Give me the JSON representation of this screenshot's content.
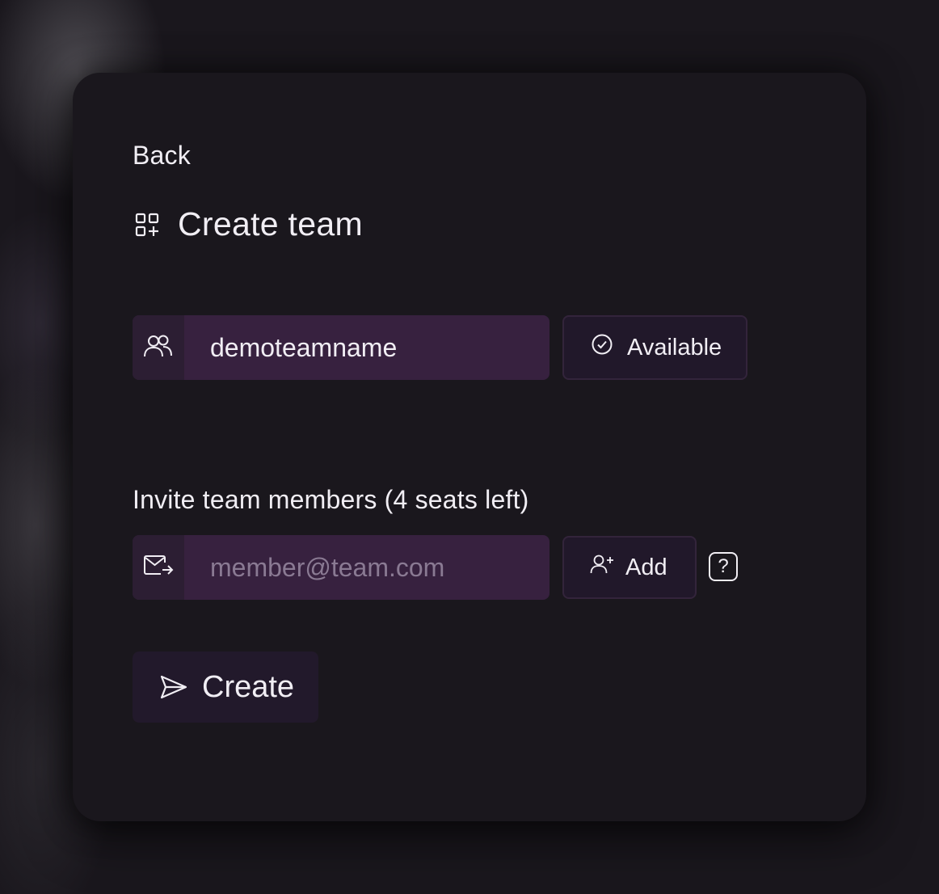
{
  "nav": {
    "back_label": "Back"
  },
  "header": {
    "title": "Create team",
    "icon": "grid-plus-icon"
  },
  "team_name": {
    "value": "demoteamname",
    "icon": "users-icon",
    "status_label": "Available",
    "status_icon": "check-circle-icon"
  },
  "invite": {
    "label": "Invite team members (4 seats left)",
    "placeholder": "member@team.com",
    "value": "",
    "icon": "mail-send-icon",
    "add_label": "Add",
    "add_icon": "user-plus-icon",
    "help_label": "?"
  },
  "actions": {
    "create_label": "Create",
    "create_icon": "send-icon"
  },
  "colors": {
    "background": "#1a171d",
    "field_bg": "#37213f",
    "field_icon_bg": "#2c1e33",
    "button_bg": "#21182a",
    "text": "#f1eef4",
    "placeholder": "#8a7a93"
  }
}
